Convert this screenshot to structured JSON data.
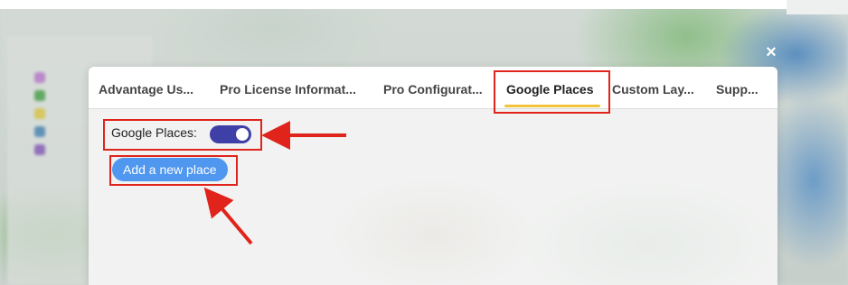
{
  "dialog": {
    "close_label": "×",
    "tabs": [
      {
        "label": "Advantage Us...",
        "active": false
      },
      {
        "label": "Pro License Informat...",
        "active": false
      },
      {
        "label": "Pro Configurat...",
        "active": false
      },
      {
        "label": "Google Places",
        "active": true
      },
      {
        "label": "Custom Lay...",
        "active": false
      },
      {
        "label": "Supp...",
        "active": false
      }
    ],
    "google_places": {
      "toggle_label": "Google Places:",
      "toggle_on": true,
      "add_button_label": "Add a new place"
    }
  },
  "colors": {
    "annotation_red": "#e0241b",
    "active_tab_underline": "#f3c33b",
    "toggle_on": "#3f3fa8",
    "button_blue": "#4f97ef"
  }
}
